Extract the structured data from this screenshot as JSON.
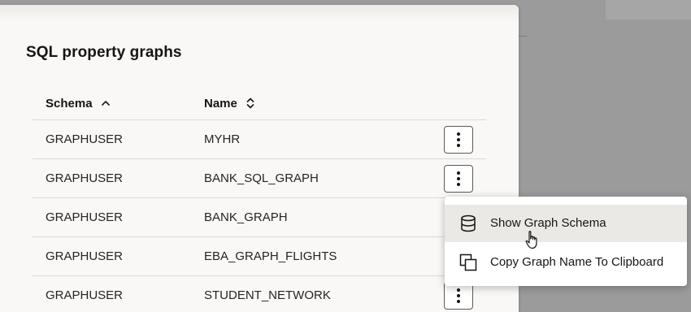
{
  "panel": {
    "title": "SQL property graphs"
  },
  "table": {
    "columns": [
      {
        "label": "Schema",
        "sort_icon": "chevron-up-icon"
      },
      {
        "label": "Name",
        "sort_icon": "sort-updown-icon"
      }
    ],
    "rows": [
      {
        "schema": "GRAPHUSER",
        "name": "MYHR"
      },
      {
        "schema": "GRAPHUSER",
        "name": "BANK_SQL_GRAPH"
      },
      {
        "schema": "GRAPHUSER",
        "name": "BANK_GRAPH"
      },
      {
        "schema": "GRAPHUSER",
        "name": "EBA_GRAPH_FLIGHTS"
      },
      {
        "schema": "GRAPHUSER",
        "name": "STUDENT_NETWORK"
      }
    ],
    "row_action_icon": "kebab-menu-icon"
  },
  "context_menu": {
    "items": [
      {
        "label": "Show Graph Schema",
        "icon": "database-icon",
        "hovered": true
      },
      {
        "label": "Copy Graph Name To Clipboard",
        "icon": "copy-icon",
        "hovered": false
      }
    ]
  },
  "colors": {
    "panel_bg": "#f9f8f6",
    "overlay_bg": "#9b9b9b",
    "row_divider": "#dcd9d4",
    "menu_hover": "#ebe9e5"
  }
}
